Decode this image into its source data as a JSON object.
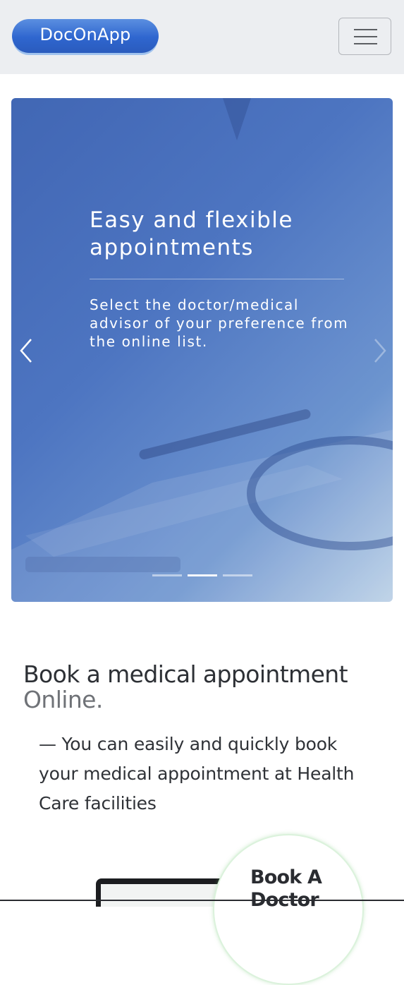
{
  "brand": {
    "name": "DocOnApp"
  },
  "nav": {
    "menu_icon": "hamburger-menu-icon"
  },
  "hero": {
    "title": "Easy and flexible appointments",
    "text": "Select the doctor/medical advisor of your preference from the online list.",
    "prev_icon": "chevron-left-icon",
    "next_icon": "chevron-right-icon",
    "slide_count": 3,
    "active_slide": 2
  },
  "section": {
    "title": "Book a medical appointment",
    "title_muted": "Online.",
    "description": "— You can easily and quickly book your medical appointment at Health Care facilities"
  },
  "promo": {
    "label": "Book A Doctor"
  }
}
